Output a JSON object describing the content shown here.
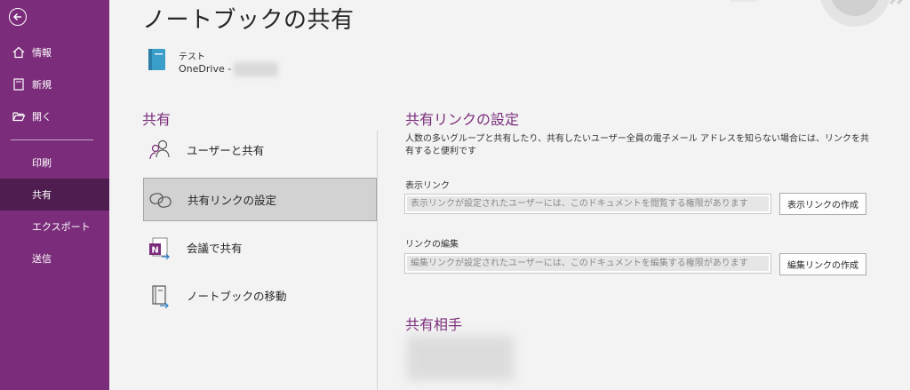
{
  "sidebar": {
    "items": [
      {
        "label": "情報",
        "icon": "home-icon"
      },
      {
        "label": "新規",
        "icon": "new-page-icon"
      },
      {
        "label": "開く",
        "icon": "folder-open-icon"
      },
      {
        "label": "印刷"
      },
      {
        "label": "共有"
      },
      {
        "label": "エクスポート"
      },
      {
        "label": "送信"
      }
    ],
    "selected_index": 4
  },
  "page": {
    "title": "ノートブックの共有",
    "notebook_name": "テスト",
    "notebook_location": "OneDrive -"
  },
  "share": {
    "heading": "共有",
    "options": [
      {
        "label": "ユーザーと共有",
        "icon": "people-icon"
      },
      {
        "label": "共有リンクの設定",
        "icon": "link-icon"
      },
      {
        "label": "会議で共有",
        "icon": "onenote-meeting-icon"
      },
      {
        "label": "ノートブックの移動",
        "icon": "move-notebook-icon"
      }
    ],
    "selected_index": 1
  },
  "link_settings": {
    "heading": "共有リンクの設定",
    "description": "人数の多いグループと共有したり、共有したいユーザー全員の電子メール アドレスを知らない場合には、リンクを共有すると便利です",
    "view": {
      "label": "表示リンク",
      "placeholder": "表示リンクが設定されたユーザーには、このドキュメントを閲覧する権限があります",
      "button": "表示リンクの作成"
    },
    "edit": {
      "label": "リンクの編集",
      "placeholder": "編集リンクが設定されたユーザーには、このドキュメントを編集する権限があります",
      "button": "編集リンクの作成"
    }
  },
  "shared_with": {
    "heading": "共有相手"
  },
  "colors": {
    "accent": "#7b2d7b",
    "sidebar_selected": "#4f1d4f"
  }
}
